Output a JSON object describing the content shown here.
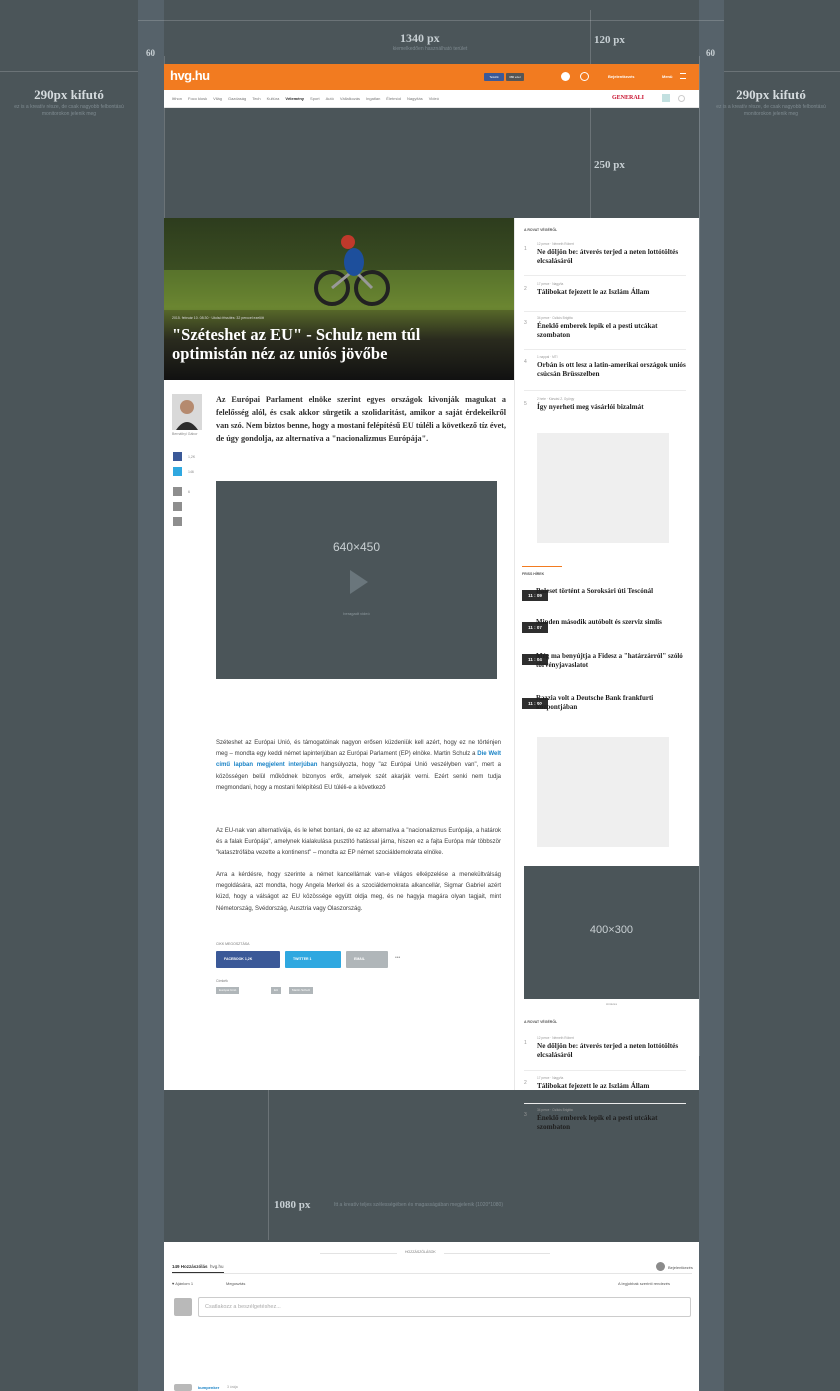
{
  "guides": {
    "total_width": "1340 px",
    "total_sub": "kiemelkedően használható terület",
    "margin_left": "60",
    "margin_right": "60",
    "right_col": "120 px",
    "ad_top": "250 px",
    "bottom_width": "1080 px",
    "bottom_sub": "Itt a kreatív teljes szélességében és magasságában megjelenik (1020*1080)"
  },
  "left_side": {
    "title": "290px kifutó",
    "sub": "ez is a kreatív része, de csak nagyobb felbontású monitorokon jelenik meg"
  },
  "right_side": {
    "title": "290px kifutó",
    "sub": "ez is a kreatív része, de csak nagyobb felbontású monitorokon jelenik meg"
  },
  "header": {
    "logo": "hvg.hu",
    "btn_like": "Tetszik",
    "btn_count": "380 ezer",
    "login": "Bejelentkezés",
    "menu": "Menü",
    "nav_items": [
      "Itthon",
      "Foco kiosk",
      "Világ",
      "Gazdaság",
      "Tech",
      "Kultúra",
      "Vélemény",
      "Sport",
      "Autó",
      "Vállalkozás",
      "Ingatlan",
      "Életmód",
      "Nagyítás",
      "Videó"
    ],
    "nav_active": "Vélemény",
    "sponsor": "GENERALI"
  },
  "article": {
    "meta": "2015. február 10. 08:30 · Utolsó frissítés: 32 perccel ezelőtt",
    "title": "\"Széteshet az EU\" - Schulz nem túl optimistán néz az uniós jövőbe",
    "author": "Bernáthyi Gábor",
    "fb_count": "1,2K",
    "tw_count": "146",
    "cmt_count": "6",
    "lead": "Az Európai Parlament elnöke szerint egyes országok kivonják magukat a felelősség alól, és csak akkor sürgetik a szolidaritást, amikor a saját érdekeikről van szó. Nem biztos benne, hogy a mostani felépítésű EU túléli a következő tíz évet, de úgy gondolja, az alternatíva a \"nacionalizmus Európája\".",
    "video_dim": "640×450",
    "video_sub": "beragadt videó",
    "para1_a": "Széteshet az Európai Unió, és támogatóinak nagyon erősen küzdeniük kell azért, hogy ez ne történjen meg – mondta egy keddi német lapinterjúban az Európai Parlament (EP) elnöke. Martin Schulz a ",
    "para1_link": "Die Welt című lapban megjelent interjúban",
    "para1_b": " hangsúlyozta, hogy \"az Európai Unió veszélyben van\", mert a közösségen belül működnek bizonyos erők, amelyek szét akarják verni. Ezért senki nem tudja megmondani, hogy a mostani felépítésű EU túléli-e a következő",
    "para2": "Az EU-nak van alternatívája, és le lehet bontani, de ez az alternatíva a \"nacionalizmus Európája, a határok és a falak Európája\", amelynek kialakulása pusztító hatással járna, hiszen ez a fajta Európa már többször \"katasztrófába vezette a kontinenst\" – mondta az EP német szociáldemokrata elnöke.",
    "para3": "Arra a kérdésre, hogy szerinte a német kancellárnak van-e világos elképzelése a menekültválság megoldására, azt mondta, hogy Angela Merkel és a szociáldemokrata alkancellár, Sigmar Gabriel azért küzd, hogy a válságot az EU közössége együtt oldja meg, és ne hagyja magára olyan tagjait, mint Németország, Svédország, Ausztria vagy Olaszország.",
    "share_label": "CIKK MEGOSZTÁSA",
    "share_fb": "FACEBOOK",
    "share_fb_count": "1,2K",
    "share_tw": "TWITTER",
    "share_tw_count": "1",
    "share_email": "EMAIL",
    "share_more": "•••",
    "tags_label": "Címkék",
    "tags": [
      "Európai Unió",
      "EU",
      "Martin Schulz"
    ]
  },
  "sidebar": {
    "head1": "A ROVAT VÉGÉRŐL",
    "items": [
      {
        "num": "1",
        "meta": "12 perce · Németh Róbert",
        "title": "Ne dőljön be: átverés terjed a neten lottótöltés elcsalásáról"
      },
      {
        "num": "2",
        "meta": "17 perce · Nagy/ta",
        "title": "Tálibokat fejezett le az Iszlám Állam"
      },
      {
        "num": "3",
        "meta": "34 perce · Csikós Brigitta",
        "title": "Éneklő emberek lepik el a pesti utcákat szombaton"
      },
      {
        "num": "4",
        "meta": "1 nappal · MTI",
        "title": "Orbán is ott lesz a latin-amerikai országok uniós csúcsán Brüsszelben"
      },
      {
        "num": "5",
        "meta": "2 hete · Kárvási Z. György",
        "title": "Így nyerheti meg vásárlói bizalmát"
      }
    ],
    "head2": "FRISS HÍREK",
    "news": [
      {
        "time": "11 : 09",
        "title": "Baleset történt a Soroksári úti Tescónál"
      },
      {
        "time": "11 : 07",
        "title": "Minden második autóbolt és szerviz simlis"
      },
      {
        "time": "11 : 04",
        "title": "Még ma benyújtja a Fidesz a \"határzárról\" szóló törvényjavaslatot"
      },
      {
        "time": "11 : 00",
        "title": "Razzia volt a Deutsche Bank frankfurti központjában"
      }
    ],
    "ad_dim": "400×300",
    "ad_label": "Hirdetés",
    "head3": "A ROVAT VÉGÉRŐL",
    "items2": [
      {
        "num": "1",
        "meta": "12 perce · Németh Róbert",
        "title": "Ne dőljön be: átverés terjed a neten lottótöltés elcsalásáról"
      },
      {
        "num": "2",
        "meta": "17 perce · Nagy/ta",
        "title": "Tálibokat fejezett le az Iszlám Állam"
      },
      {
        "num": "3",
        "meta": "34 perce · Csikós Brigitta",
        "title": "Éneklő emberek lepik el a pesti utcákat szombaton"
      }
    ]
  },
  "comments": {
    "head": "HOZZÁSZÓLÁSOK",
    "count": "149 Hozzászólás",
    "site": "hvg.hu",
    "login": "Bejelentkezés",
    "recommend": "Ajánlom",
    "recommend_count": "1",
    "share": "Megosztás",
    "sort": "A legjobbak szerinti rendezés",
    "placeholder": "Csatlakozz a beszélgetéshez...",
    "first_user": "kumpenker",
    "first_time": "3 órája"
  },
  "colors": {
    "brand": "#f27b20",
    "facebook": "#3b5998",
    "twitter": "#2fa8e0",
    "link": "#1a83c6"
  }
}
